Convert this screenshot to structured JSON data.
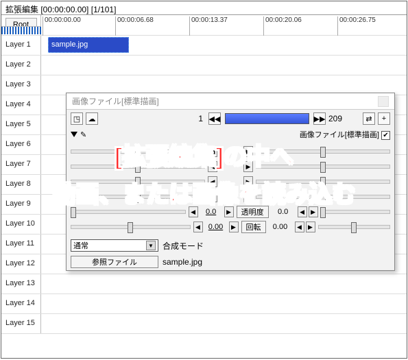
{
  "title": "拡張編集 [00:00:00.00] [1/101]",
  "root_button": "Root",
  "ruler": [
    "00:00:00.00",
    "00:00:06.68",
    "00:00:13.37",
    "00:00:20.06",
    "00:00:26.75"
  ],
  "layers": [
    "Layer 1",
    "Layer 2",
    "Layer 3",
    "Layer 4",
    "Layer 5",
    "Layer 6",
    "Layer 7",
    "Layer 8",
    "Layer 9",
    "Layer 10",
    "Layer 11",
    "Layer 12",
    "Layer 13",
    "Layer 14",
    "Layer 15"
  ],
  "clip_label": "sample.jpg",
  "dialog": {
    "title": "画像ファイル[標準描画]",
    "frame_start": "1",
    "frame_end": "209",
    "section_label": "画像ファイル[標準描画]",
    "check_mark": "✔",
    "params": {
      "opacity": {
        "val": "0.0",
        "label": "透明度",
        "right": "0.0"
      },
      "rotation": {
        "val": "0.00",
        "label": "回転",
        "right": "0.00"
      }
    },
    "blend_label": "合成モード",
    "blend_value": "通常",
    "ref_button": "参照ファイル",
    "ref_value": "sample.jpg"
  },
  "overlay": {
    "line1": "[拡張編集]の中へ",
    "line2": "動画、または画像を読み込む"
  },
  "icons": {
    "prev": "◀◀",
    "next": "▶▶",
    "swap": "⇄",
    "plus": "+",
    "left": "◀",
    "right": "▶",
    "down": "▼",
    "camera": "◳",
    "cloud": "☁"
  }
}
